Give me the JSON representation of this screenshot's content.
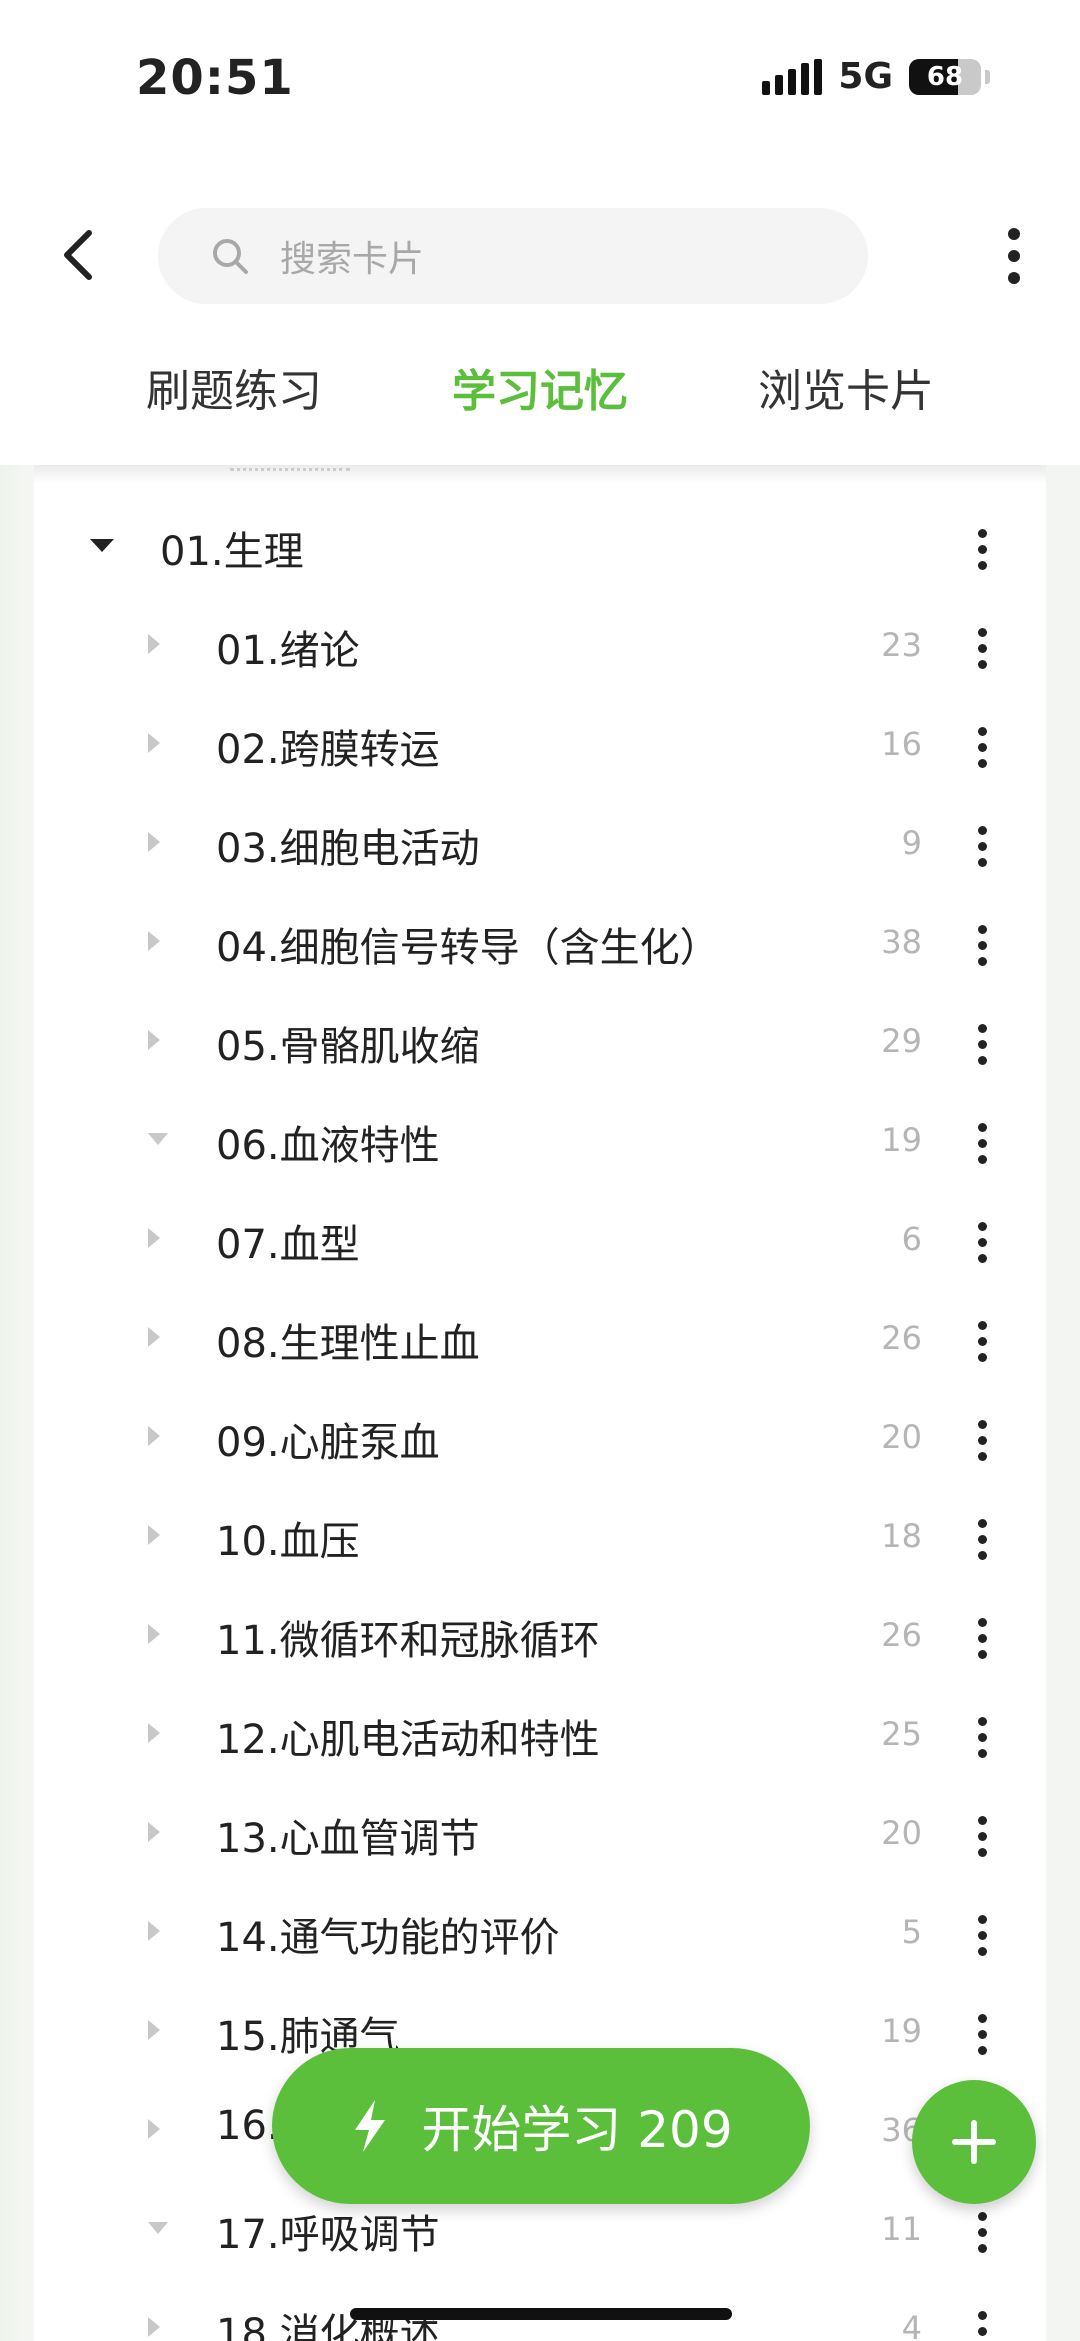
{
  "status_bar": {
    "time": "20:51",
    "network": "5G",
    "battery": "68",
    "battery_level": 0.68
  },
  "header": {
    "search_placeholder": "搜索卡片",
    "tabs": [
      {
        "label": "刷题练习",
        "active": false
      },
      {
        "label": "学习记忆",
        "active": true
      },
      {
        "label": "浏览卡片",
        "active": false
      }
    ]
  },
  "tree": {
    "parent": {
      "label": "01.生理",
      "expanded": true
    },
    "items": [
      {
        "label": "01.绪论",
        "count": "23",
        "state": "collapsed"
      },
      {
        "label": "02.跨膜转运",
        "count": "16",
        "state": "collapsed"
      },
      {
        "label": "03.细胞电活动",
        "count": "9",
        "state": "collapsed"
      },
      {
        "label": "04.细胞信号转导（含生化）",
        "count": "38",
        "state": "collapsed"
      },
      {
        "label": "05.骨骼肌收缩",
        "count": "29",
        "state": "collapsed"
      },
      {
        "label": "06.血液特性",
        "count": "19",
        "state": "expanded"
      },
      {
        "label": "07.血型",
        "count": "6",
        "state": "collapsed"
      },
      {
        "label": "08.生理性止血",
        "count": "26",
        "state": "collapsed"
      },
      {
        "label": "09.心脏泵血",
        "count": "20",
        "state": "collapsed"
      },
      {
        "label": "10.血压",
        "count": "18",
        "state": "collapsed"
      },
      {
        "label": "11.微循环和冠脉循环",
        "count": "26",
        "state": "collapsed"
      },
      {
        "label": "12.心肌电活动和特性",
        "count": "25",
        "state": "collapsed"
      },
      {
        "label": "13.心血管调节",
        "count": "20",
        "state": "collapsed"
      },
      {
        "label": "14.通气功能的评价",
        "count": "5",
        "state": "collapsed"
      },
      {
        "label": "15.肺通气",
        "count": "19",
        "state": "collapsed"
      },
      {
        "label": "16.",
        "count": "36",
        "state": "collapsed"
      },
      {
        "label": "17.呼吸调节",
        "count": "11",
        "state": "expanded"
      },
      {
        "label": "18.消化概述",
        "count": "4",
        "state": "collapsed"
      }
    ]
  },
  "actions": {
    "start_label": "开始学习 209"
  },
  "colors": {
    "accent": "#5cbf3c",
    "count_gray": "#b5b5b5"
  }
}
